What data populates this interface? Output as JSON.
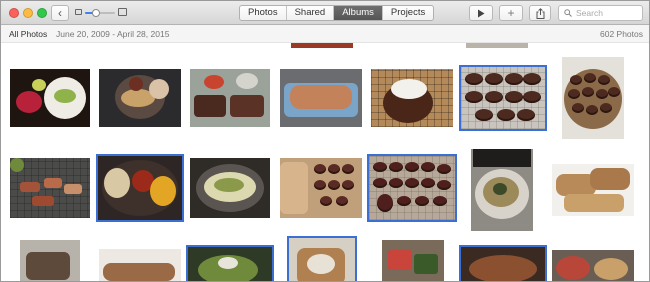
{
  "window": {
    "buttons": {
      "close": "close-button",
      "minimize": "minimize-button",
      "zoom": "zoom-button"
    }
  },
  "toolbar": {
    "back_icon": "‹",
    "zoom_level": 0.35,
    "tabs": [
      {
        "label": "Photos",
        "active": false
      },
      {
        "label": "Shared",
        "active": false
      },
      {
        "label": "Albums",
        "active": true
      },
      {
        "label": "Projects",
        "active": false
      }
    ],
    "play_icon": "play-icon",
    "add_icon": "+",
    "share_icon": "share-icon",
    "search_placeholder": "Search"
  },
  "header": {
    "title": "All Photos",
    "date_range": "June 20, 2009 - April 28, 2015",
    "count": "602 Photos"
  },
  "colors": {
    "accent": "#3b6fd4",
    "active_tab": "#5e5e5e"
  }
}
